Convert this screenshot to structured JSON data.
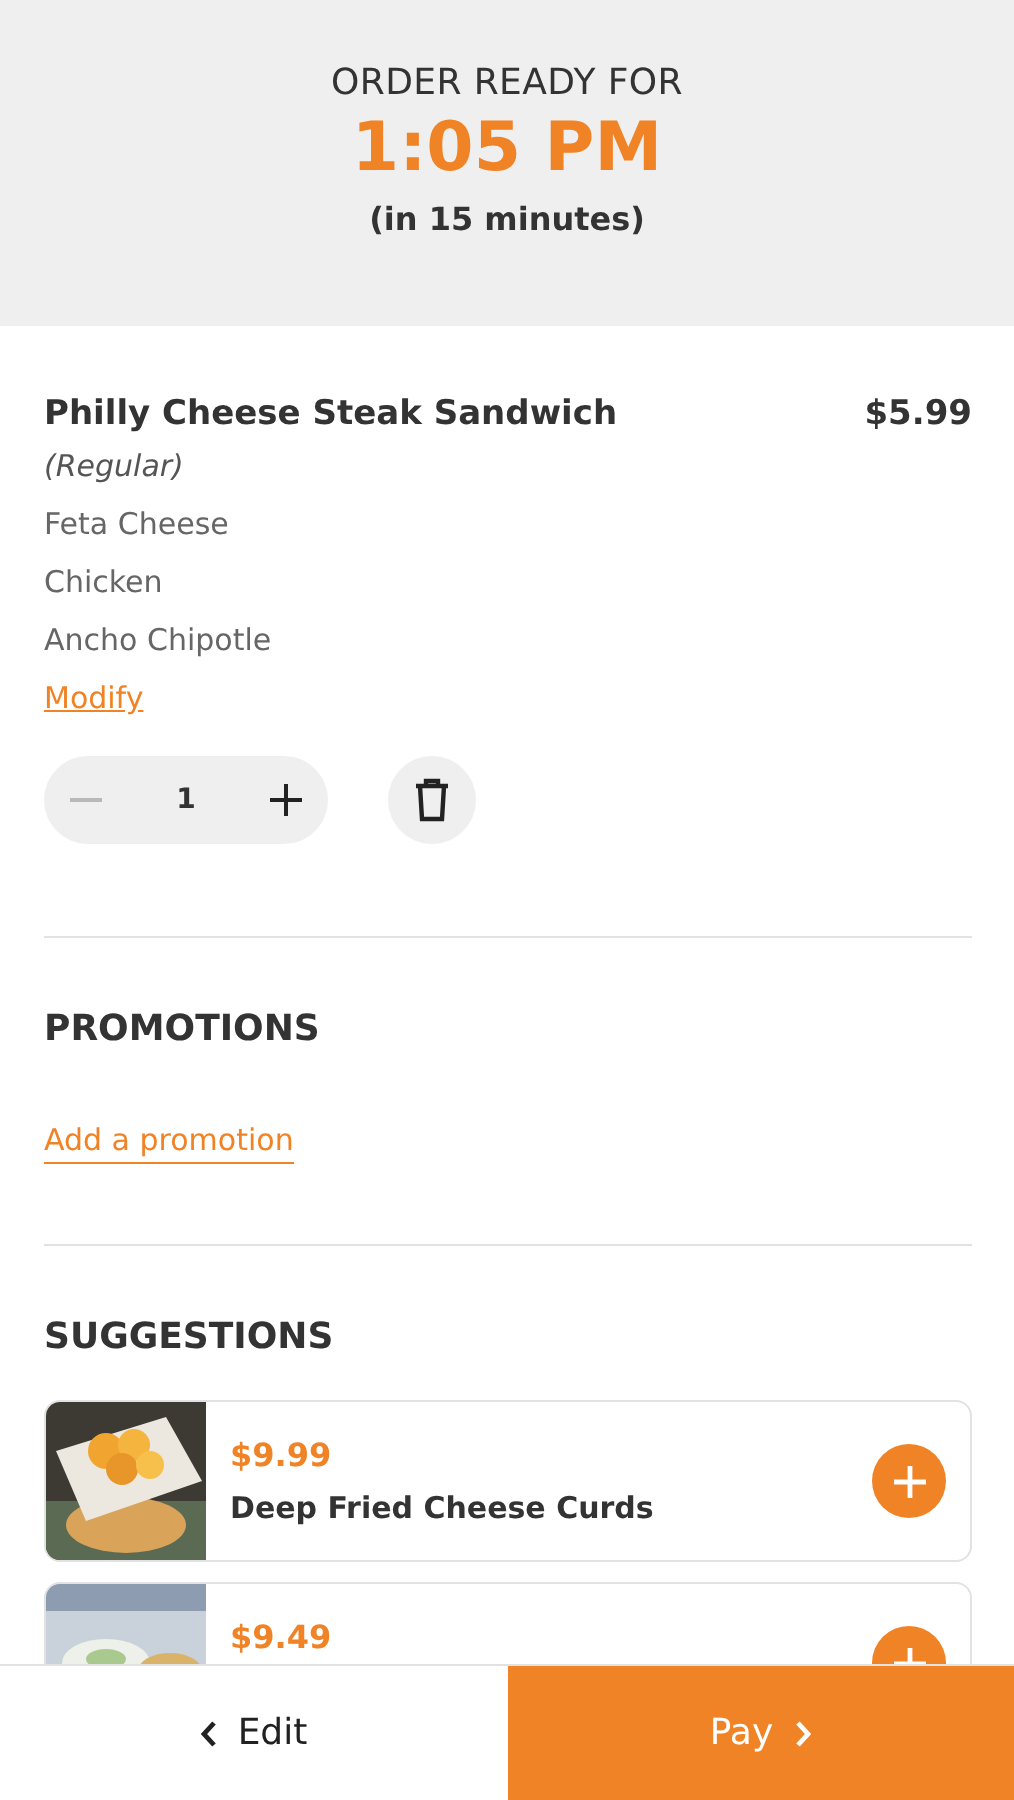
{
  "header": {
    "label": "ORDER READY FOR",
    "time": "1:05 PM",
    "eta": "(in 15 minutes)"
  },
  "item": {
    "name": "Philly Cheese Steak Sandwich",
    "price": "$5.99",
    "size": "(Regular)",
    "options": [
      "Feta Cheese",
      "Chicken",
      "Ancho Chipotle"
    ],
    "modify": "Modify",
    "quantity": "1",
    "decrease_disabled": true
  },
  "promotions": {
    "title": "PROMOTIONS",
    "link": "Add a promotion"
  },
  "suggestions": {
    "title": "SUGGESTIONS",
    "items": [
      {
        "kind": "picture",
        "price": "$9.99",
        "name": "Deep Fried Cheese Curds"
      },
      {
        "kind": "picture",
        "price": "$9.49"
      }
    ]
  },
  "footer": {
    "edit": "Edit",
    "pay": "Pay"
  }
}
